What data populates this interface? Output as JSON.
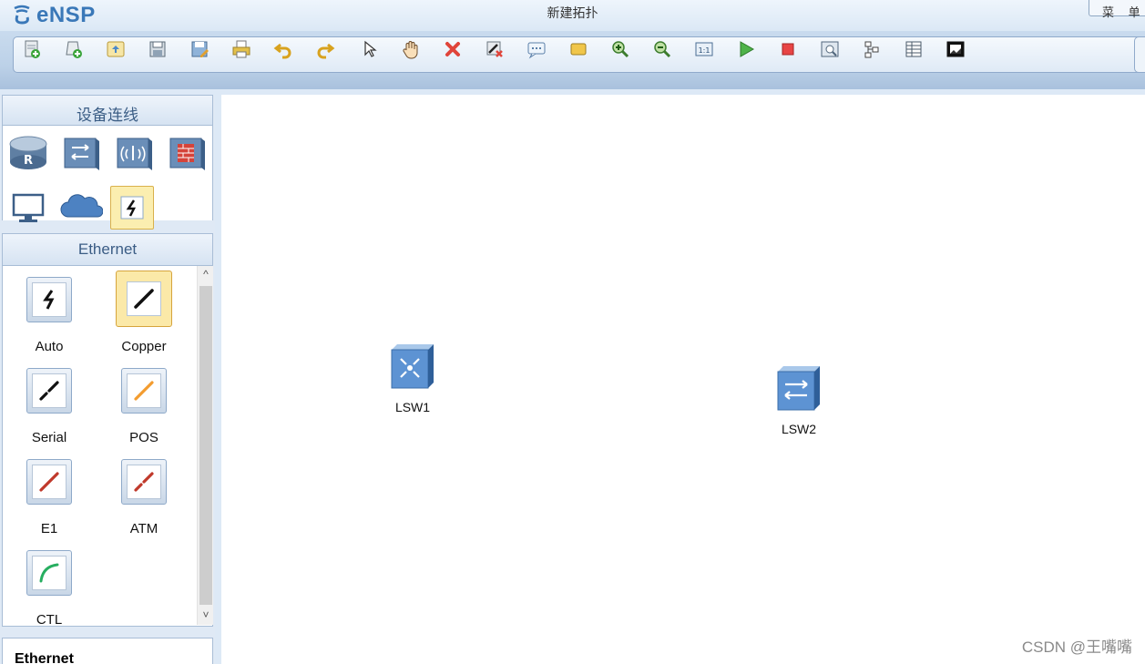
{
  "app": {
    "logo_text": "eNSP",
    "window_title": "新建拓扑",
    "menu_button_label": "菜 单"
  },
  "toolbar": {
    "buttons": [
      "new-topology-icon",
      "new-experiment-icon",
      "open-icon",
      "save-icon",
      "save-as-icon",
      "print-icon",
      "undo-icon",
      "redo-icon",
      "select-pointer-icon",
      "pan-hand-icon",
      "delete-icon",
      "delete-link-icon",
      "text-note-icon",
      "rectangle-icon",
      "zoom-in-icon",
      "zoom-out-icon",
      "fit-view-icon",
      "start-device-icon",
      "stop-device-icon",
      "capture-data-icon",
      "topology-display-icon",
      "grid-icon",
      "screenshot-icon"
    ]
  },
  "left_panel": {
    "device_section_title": "设备连线",
    "device_categories": [
      "router-icon",
      "switch-icon",
      "wireless-icon",
      "firewall-icon",
      "pc-terminal-icon",
      "cloud-icon",
      "cable-icon"
    ],
    "selected_category": "cable-icon",
    "cable_section_title": "Ethernet",
    "cables": [
      {
        "label": "Auto",
        "color": "#111111"
      },
      {
        "label": "Copper",
        "color": "#111111"
      },
      {
        "label": "Serial",
        "color": "#111111"
      },
      {
        "label": "POS",
        "color": "#f39c2f"
      },
      {
        "label": "E1",
        "color": "#c0392b"
      },
      {
        "label": "ATM",
        "color": "#c0392b"
      },
      {
        "label": "CTL",
        "color": "#27ae60"
      }
    ],
    "selected_cable": "Copper",
    "description_title": "Ethernet"
  },
  "canvas": {
    "devices": [
      {
        "label": "LSW1",
        "type": "layer3-switch"
      },
      {
        "label": "LSW2",
        "type": "layer2-switch"
      }
    ]
  },
  "watermark": "CSDN @王嘴嘴",
  "colors": {
    "accent": "#3a78b8",
    "selected_highlight": "#fbe9a8",
    "panel_bg": "#dfe9f5"
  }
}
